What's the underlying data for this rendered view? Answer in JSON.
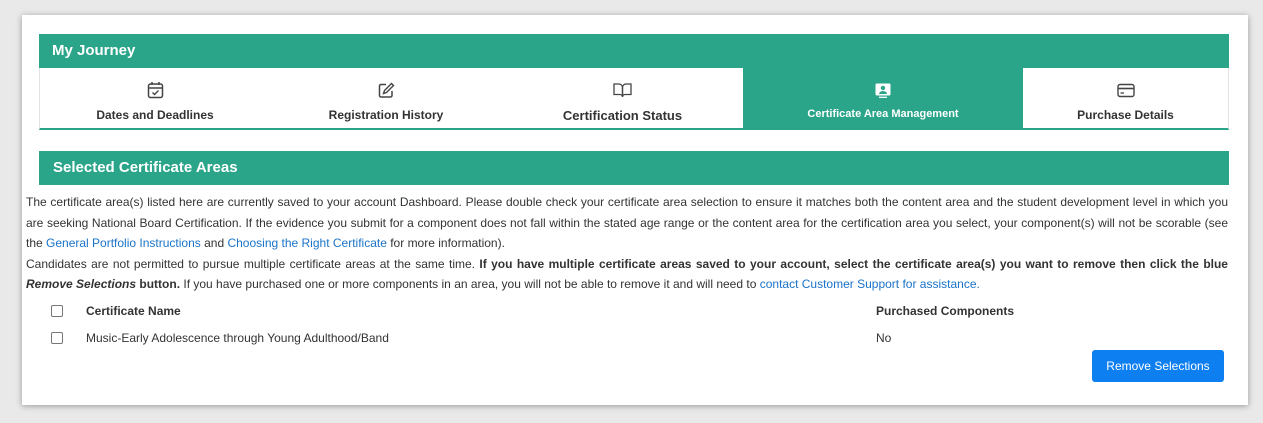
{
  "journey": {
    "title": "My Journey",
    "tabs": [
      {
        "label": "Dates and Deadlines",
        "icon": "calendar-check-icon"
      },
      {
        "label": "Registration History",
        "icon": "edit-icon"
      },
      {
        "label": "Certification Status",
        "icon": "book-icon"
      },
      {
        "label": "Certificate Area Management",
        "icon": "presentation-icon",
        "active": true
      },
      {
        "label": "Purchase Details",
        "icon": "credit-card-icon"
      }
    ]
  },
  "section": {
    "title": "Selected Certificate Areas"
  },
  "description": {
    "p1_start": "The certificate area(s) listed here are currently saved to your account Dashboard. Please double check your certificate area selection to ensure it matches both the content area and the student development level in which you are seeking National Board Certification. If the evidence you submit for a component does not fall within the stated age range or the content area for the certification area you select, your component(s) will not be scorable (see the ",
    "link_portfolio": "General Portfolio Instructions",
    "p1_and": " and ",
    "link_choosing": "Choosing the Right Certificate",
    "p1_end": " for more information).",
    "p2_start": "Candidates are not permitted to pursue multiple certificate areas at the same time. ",
    "p2_bold": "If you have multiple certificate areas saved to your account, select the certificate area(s) you want to remove then click the blue ",
    "p2_bold_italic": "Remove Selections",
    "p2_bold_end": " button.",
    "p2_rest": " If you have purchased one or more components in an area, you will not be able to remove it and will need to ",
    "link_support": "contact Customer Support for assistance."
  },
  "table": {
    "headers": {
      "name": "Certificate Name",
      "purchased": "Purchased Components"
    },
    "rows": [
      {
        "name": "Music-Early Adolescence through Young Adulthood/Band",
        "purchased": "No"
      }
    ]
  },
  "buttons": {
    "remove_label": "Remove Selections"
  },
  "colors": {
    "accent": "#2aa58a",
    "link": "#1a73c8",
    "button": "#0d7ff0"
  }
}
